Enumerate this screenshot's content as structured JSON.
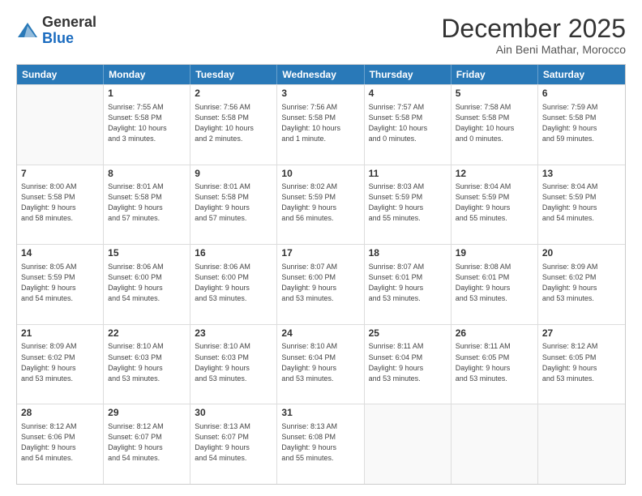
{
  "header": {
    "logo_general": "General",
    "logo_blue": "Blue",
    "month_title": "December 2025",
    "location": "Ain Beni Mathar, Morocco"
  },
  "calendar": {
    "days_of_week": [
      "Sunday",
      "Monday",
      "Tuesday",
      "Wednesday",
      "Thursday",
      "Friday",
      "Saturday"
    ],
    "rows": [
      [
        {
          "day": "",
          "info": ""
        },
        {
          "day": "1",
          "info": "Sunrise: 7:55 AM\nSunset: 5:58 PM\nDaylight: 10 hours\nand 3 minutes."
        },
        {
          "day": "2",
          "info": "Sunrise: 7:56 AM\nSunset: 5:58 PM\nDaylight: 10 hours\nand 2 minutes."
        },
        {
          "day": "3",
          "info": "Sunrise: 7:56 AM\nSunset: 5:58 PM\nDaylight: 10 hours\nand 1 minute."
        },
        {
          "day": "4",
          "info": "Sunrise: 7:57 AM\nSunset: 5:58 PM\nDaylight: 10 hours\nand 0 minutes."
        },
        {
          "day": "5",
          "info": "Sunrise: 7:58 AM\nSunset: 5:58 PM\nDaylight: 10 hours\nand 0 minutes."
        },
        {
          "day": "6",
          "info": "Sunrise: 7:59 AM\nSunset: 5:58 PM\nDaylight: 9 hours\nand 59 minutes."
        }
      ],
      [
        {
          "day": "7",
          "info": ""
        },
        {
          "day": "8",
          "info": "Sunrise: 8:01 AM\nSunset: 5:58 PM\nDaylight: 9 hours\nand 57 minutes."
        },
        {
          "day": "9",
          "info": "Sunrise: 8:01 AM\nSunset: 5:58 PM\nDaylight: 9 hours\nand 57 minutes."
        },
        {
          "day": "10",
          "info": "Sunrise: 8:02 AM\nSunset: 5:59 PM\nDaylight: 9 hours\nand 56 minutes."
        },
        {
          "day": "11",
          "info": "Sunrise: 8:03 AM\nSunset: 5:59 PM\nDaylight: 9 hours\nand 55 minutes."
        },
        {
          "day": "12",
          "info": "Sunrise: 8:04 AM\nSunset: 5:59 PM\nDaylight: 9 hours\nand 55 minutes."
        },
        {
          "day": "13",
          "info": "Sunrise: 8:04 AM\nSunset: 5:59 PM\nDaylight: 9 hours\nand 54 minutes."
        }
      ],
      [
        {
          "day": "14",
          "info": ""
        },
        {
          "day": "15",
          "info": "Sunrise: 8:06 AM\nSunset: 6:00 PM\nDaylight: 9 hours\nand 54 minutes."
        },
        {
          "day": "16",
          "info": "Sunrise: 8:06 AM\nSunset: 6:00 PM\nDaylight: 9 hours\nand 53 minutes."
        },
        {
          "day": "17",
          "info": "Sunrise: 8:07 AM\nSunset: 6:00 PM\nDaylight: 9 hours\nand 53 minutes."
        },
        {
          "day": "18",
          "info": "Sunrise: 8:07 AM\nSunset: 6:01 PM\nDaylight: 9 hours\nand 53 minutes."
        },
        {
          "day": "19",
          "info": "Sunrise: 8:08 AM\nSunset: 6:01 PM\nDaylight: 9 hours\nand 53 minutes."
        },
        {
          "day": "20",
          "info": "Sunrise: 8:09 AM\nSunset: 6:02 PM\nDaylight: 9 hours\nand 53 minutes."
        }
      ],
      [
        {
          "day": "21",
          "info": ""
        },
        {
          "day": "22",
          "info": "Sunrise: 8:10 AM\nSunset: 6:03 PM\nDaylight: 9 hours\nand 53 minutes."
        },
        {
          "day": "23",
          "info": "Sunrise: 8:10 AM\nSunset: 6:03 PM\nDaylight: 9 hours\nand 53 minutes."
        },
        {
          "day": "24",
          "info": "Sunrise: 8:10 AM\nSunset: 6:04 PM\nDaylight: 9 hours\nand 53 minutes."
        },
        {
          "day": "25",
          "info": "Sunrise: 8:11 AM\nSunset: 6:04 PM\nDaylight: 9 hours\nand 53 minutes."
        },
        {
          "day": "26",
          "info": "Sunrise: 8:11 AM\nSunset: 6:05 PM\nDaylight: 9 hours\nand 53 minutes."
        },
        {
          "day": "27",
          "info": "Sunrise: 8:12 AM\nSunset: 6:05 PM\nDaylight: 9 hours\nand 53 minutes."
        }
      ],
      [
        {
          "day": "28",
          "info": "Sunrise: 8:12 AM\nSunset: 6:06 PM\nDaylight: 9 hours\nand 54 minutes."
        },
        {
          "day": "29",
          "info": "Sunrise: 8:12 AM\nSunset: 6:07 PM\nDaylight: 9 hours\nand 54 minutes."
        },
        {
          "day": "30",
          "info": "Sunrise: 8:13 AM\nSunset: 6:07 PM\nDaylight: 9 hours\nand 54 minutes."
        },
        {
          "day": "31",
          "info": "Sunrise: 8:13 AM\nSunset: 6:08 PM\nDaylight: 9 hours\nand 55 minutes."
        },
        {
          "day": "",
          "info": ""
        },
        {
          "day": "",
          "info": ""
        },
        {
          "day": "",
          "info": ""
        }
      ]
    ]
  }
}
